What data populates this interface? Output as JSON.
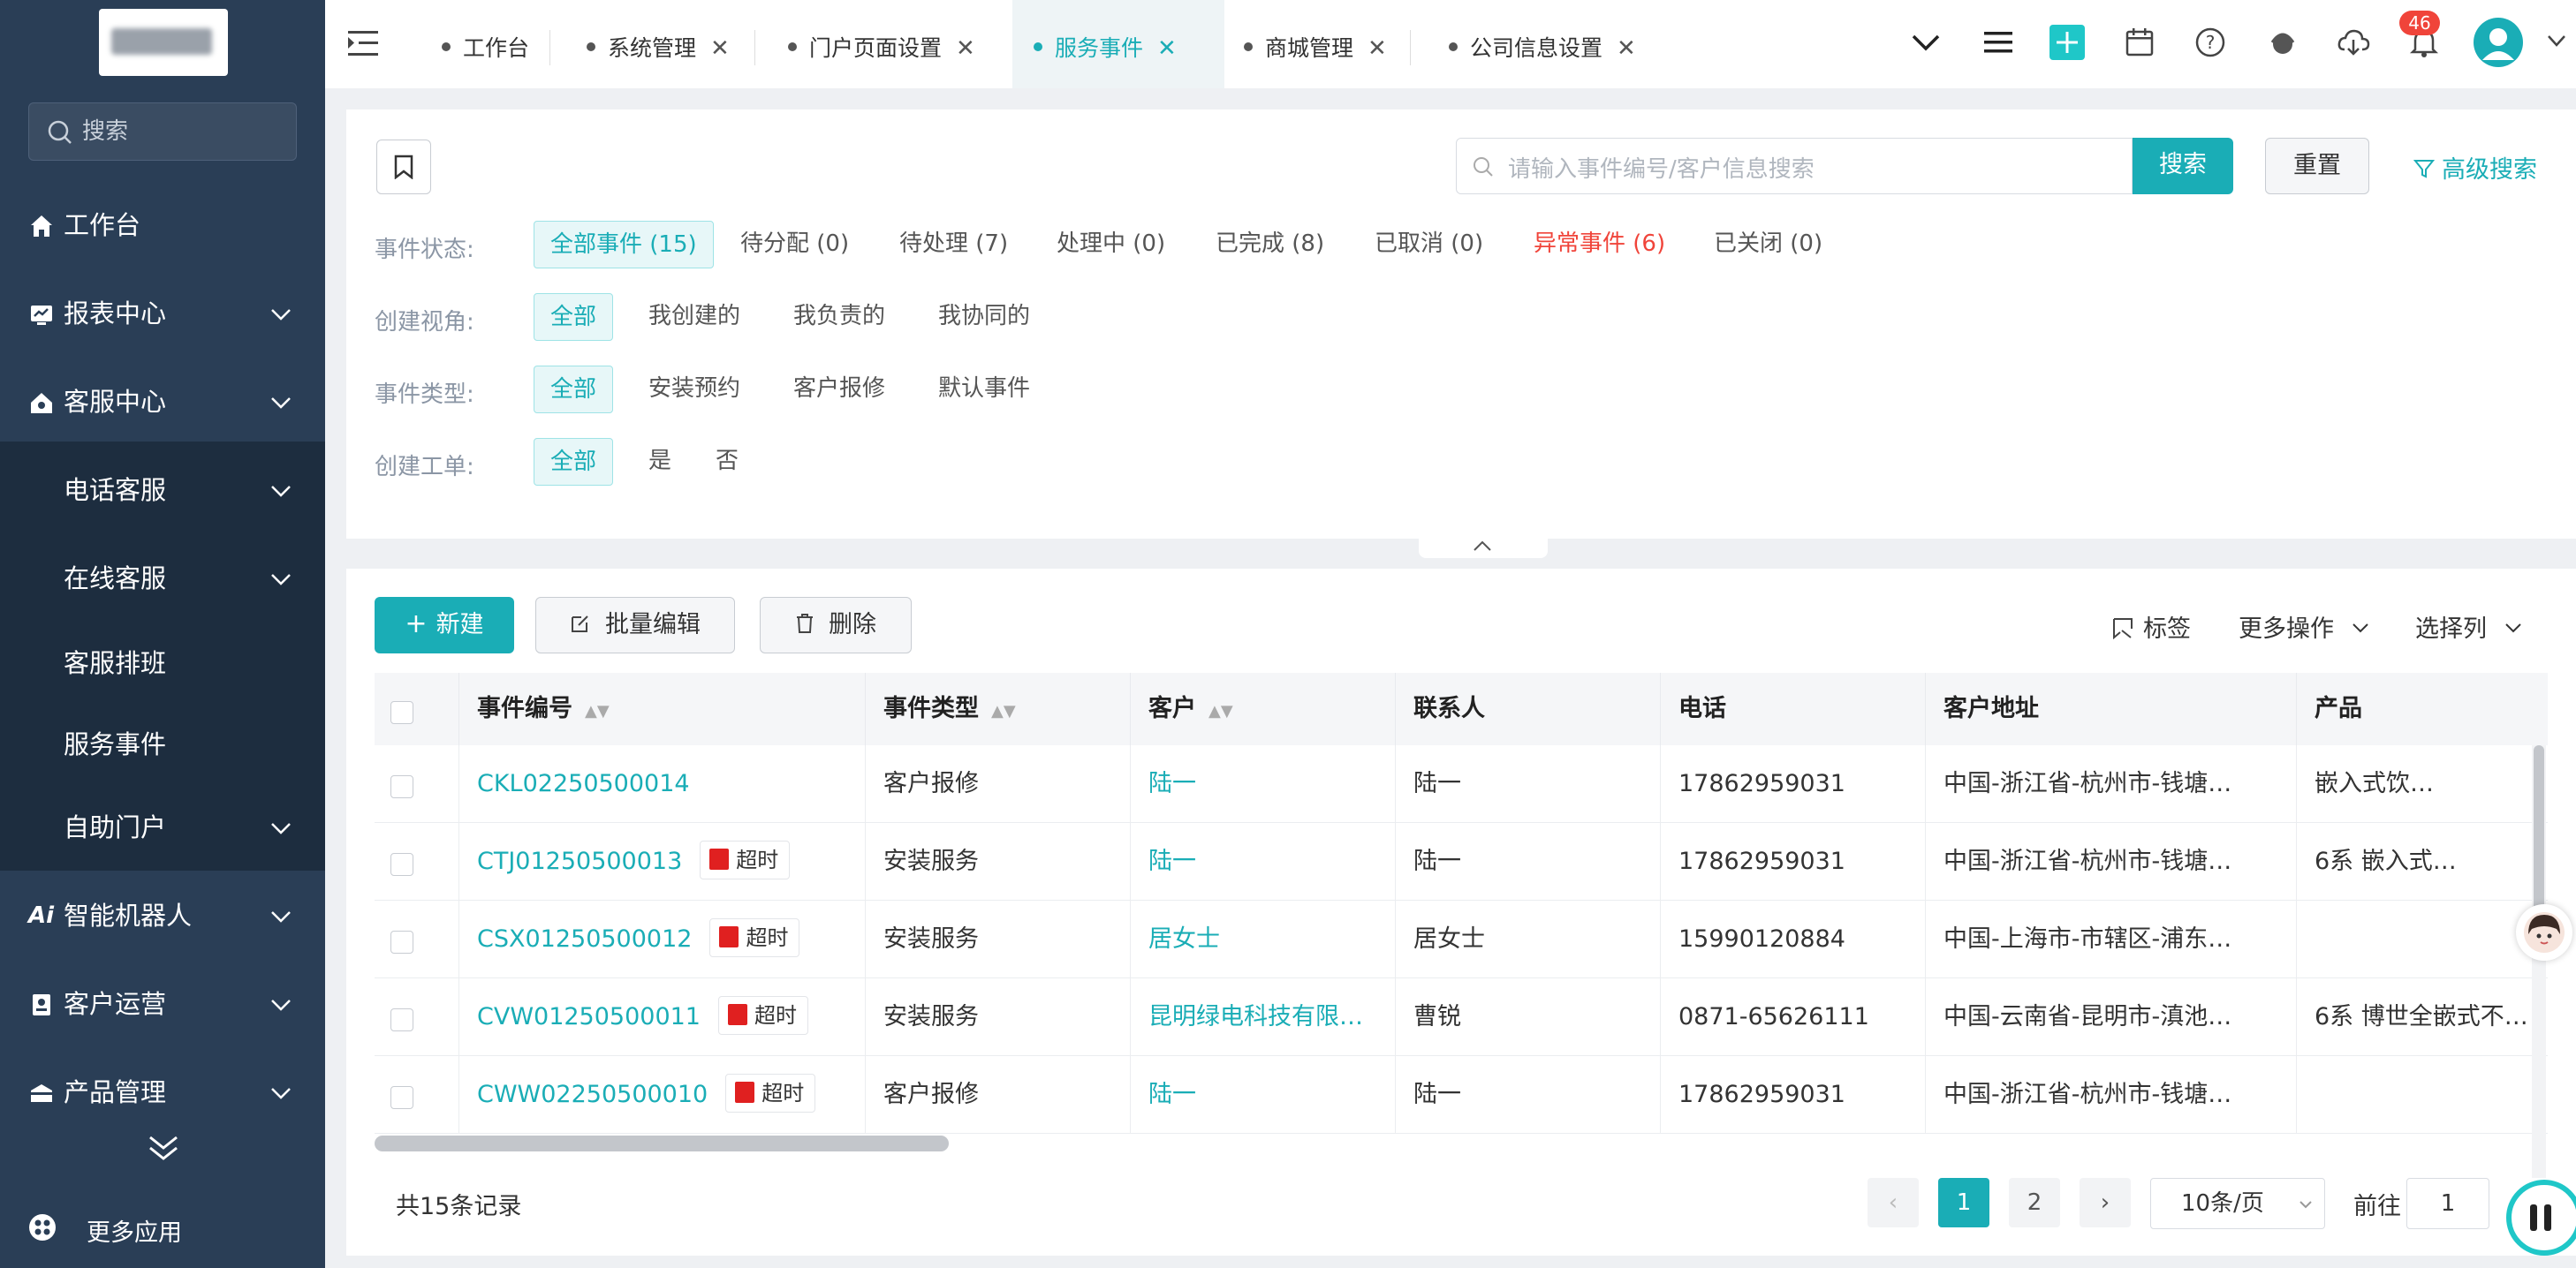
{
  "sidebar": {
    "search_placeholder": "搜索",
    "items": [
      {
        "label": "工作台",
        "icon": "home-icon"
      },
      {
        "label": "报表中心",
        "icon": "chart-icon"
      },
      {
        "label": "客服中心",
        "icon": "house-icon"
      },
      {
        "label": "电话客服"
      },
      {
        "label": "在线客服"
      },
      {
        "label": "客服排班"
      },
      {
        "label": "服务事件"
      },
      {
        "label": "自助门户"
      },
      {
        "label": "智能机器人",
        "icon": "ai-icon"
      },
      {
        "label": "客户运营",
        "icon": "contact-icon"
      },
      {
        "label": "产品管理",
        "icon": "box-icon"
      }
    ],
    "more_apps": "更多应用"
  },
  "tabs": [
    {
      "label": "工作台"
    },
    {
      "label": "系统管理"
    },
    {
      "label": "门户页面设置"
    },
    {
      "label": "服务事件"
    },
    {
      "label": "商城管理"
    },
    {
      "label": "公司信息设置"
    }
  ],
  "topbar": {
    "notification_count": "46"
  },
  "filters": {
    "search_placeholder": "请输入事件编号/客户信息搜索",
    "search_btn": "搜索",
    "reset_btn": "重置",
    "advanced": "高级搜索",
    "status_label": "事件状态:",
    "status": [
      "全部事件 (15)",
      "待分配 (0)",
      "待处理 (7)",
      "处理中 (0)",
      "已完成 (8)",
      "已取消 (0)",
      "异常事件 (6)",
      "已关闭 (0)"
    ],
    "view_label": "创建视角:",
    "view": [
      "全部",
      "我创建的",
      "我负责的",
      "我协同的"
    ],
    "type_label": "事件类型:",
    "type": [
      "全部",
      "安装预约",
      "客户报修",
      "默认事件"
    ],
    "ticket_label": "创建工单:",
    "ticket": [
      "全部",
      "是",
      "否"
    ]
  },
  "toolbar": {
    "new": "新建",
    "batch_edit": "批量编辑",
    "delete": "删除",
    "tag": "标签",
    "more": "更多操作",
    "columns": "选择列"
  },
  "table": {
    "headers": [
      "事件编号",
      "事件类型",
      "客户",
      "联系人",
      "电话",
      "客户地址",
      "产品"
    ],
    "overdue_label": "超时",
    "rows": [
      {
        "id": "CKL02250500014",
        "overdue": false,
        "type": "客户报修",
        "customer": "陆一",
        "contact": "陆一",
        "phone": "17862959031",
        "address": "中国-浙江省-杭州市-钱塘…",
        "product": "嵌入式饮…"
      },
      {
        "id": "CTJ01250500013",
        "overdue": true,
        "type": "安装服务",
        "customer": "陆一",
        "contact": "陆一",
        "phone": "17862959031",
        "address": "中国-浙江省-杭州市-钱塘…",
        "product": "6系 嵌入式…"
      },
      {
        "id": "CSX01250500012",
        "overdue": true,
        "type": "安装服务",
        "customer": "居女士",
        "contact": "居女士",
        "phone": "15990120884",
        "address": "中国-上海市-市辖区-浦东…",
        "product": ""
      },
      {
        "id": "CVW01250500011",
        "overdue": true,
        "type": "安装服务",
        "customer": "昆明绿电科技有限…",
        "contact": "曹锐",
        "phone": "0871-65626111",
        "address": "中国-云南省-昆明市-滇池…",
        "product": "6系 博世全嵌式不…"
      },
      {
        "id": "CWW02250500010",
        "overdue": true,
        "type": "客户报修",
        "customer": "陆一",
        "contact": "陆一",
        "phone": "17862959031",
        "address": "中国-浙江省-杭州市-钱塘…",
        "product": ""
      }
    ]
  },
  "pagination": {
    "total": "共15条记录",
    "pages": [
      "1",
      "2"
    ],
    "page_size": "10条/页",
    "goto": "前往",
    "goto_value": "1"
  },
  "colors": {
    "accent": "#1aadb6",
    "sidebar": "#2a3e56",
    "danger": "#f0443a"
  }
}
